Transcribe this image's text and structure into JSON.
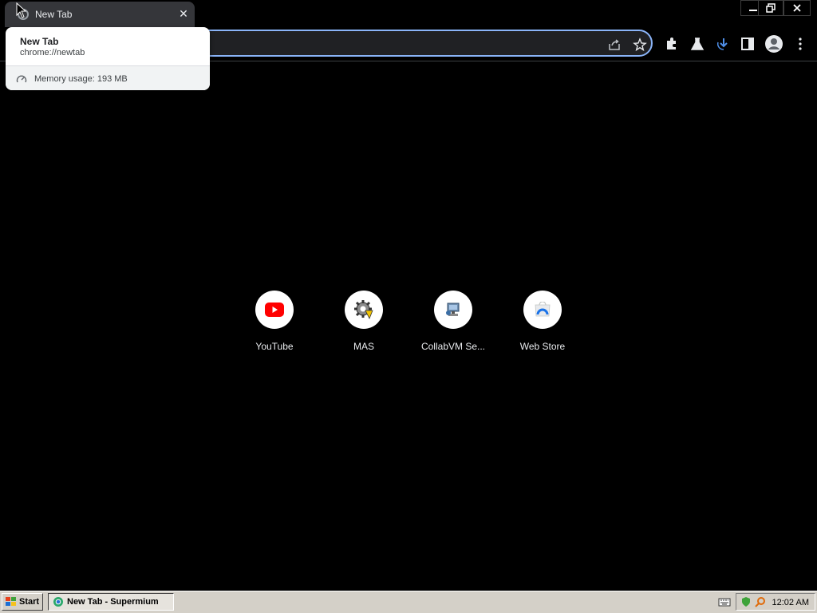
{
  "browser": {
    "tab": {
      "title": "New Tab",
      "close": "✕"
    },
    "hovercard": {
      "title": "New Tab",
      "url": "chrome://newtab",
      "memory": "Memory usage: 193 MB"
    },
    "toolbar_icons": [
      "share-icon",
      "bookmark-star-icon",
      "extensions-icon",
      "labs-flask-icon",
      "download-icon",
      "side-panel-icon",
      "profile-icon",
      "menu-icon"
    ],
    "accent_color": "#8ab4f8"
  },
  "shortcuts": [
    {
      "label": "YouTube",
      "icon": "youtube-icon",
      "color": "#ff0000"
    },
    {
      "label": "MAS",
      "icon": "mas-gear-icon"
    },
    {
      "label": "CollabVM Se...",
      "icon": "collabvm-icon"
    },
    {
      "label": "Web Store",
      "icon": "web-store-icon"
    }
  ],
  "taskbar": {
    "start_label": "Start",
    "task_label": "New Tab - Supermium",
    "clock": "12:02 AM"
  }
}
